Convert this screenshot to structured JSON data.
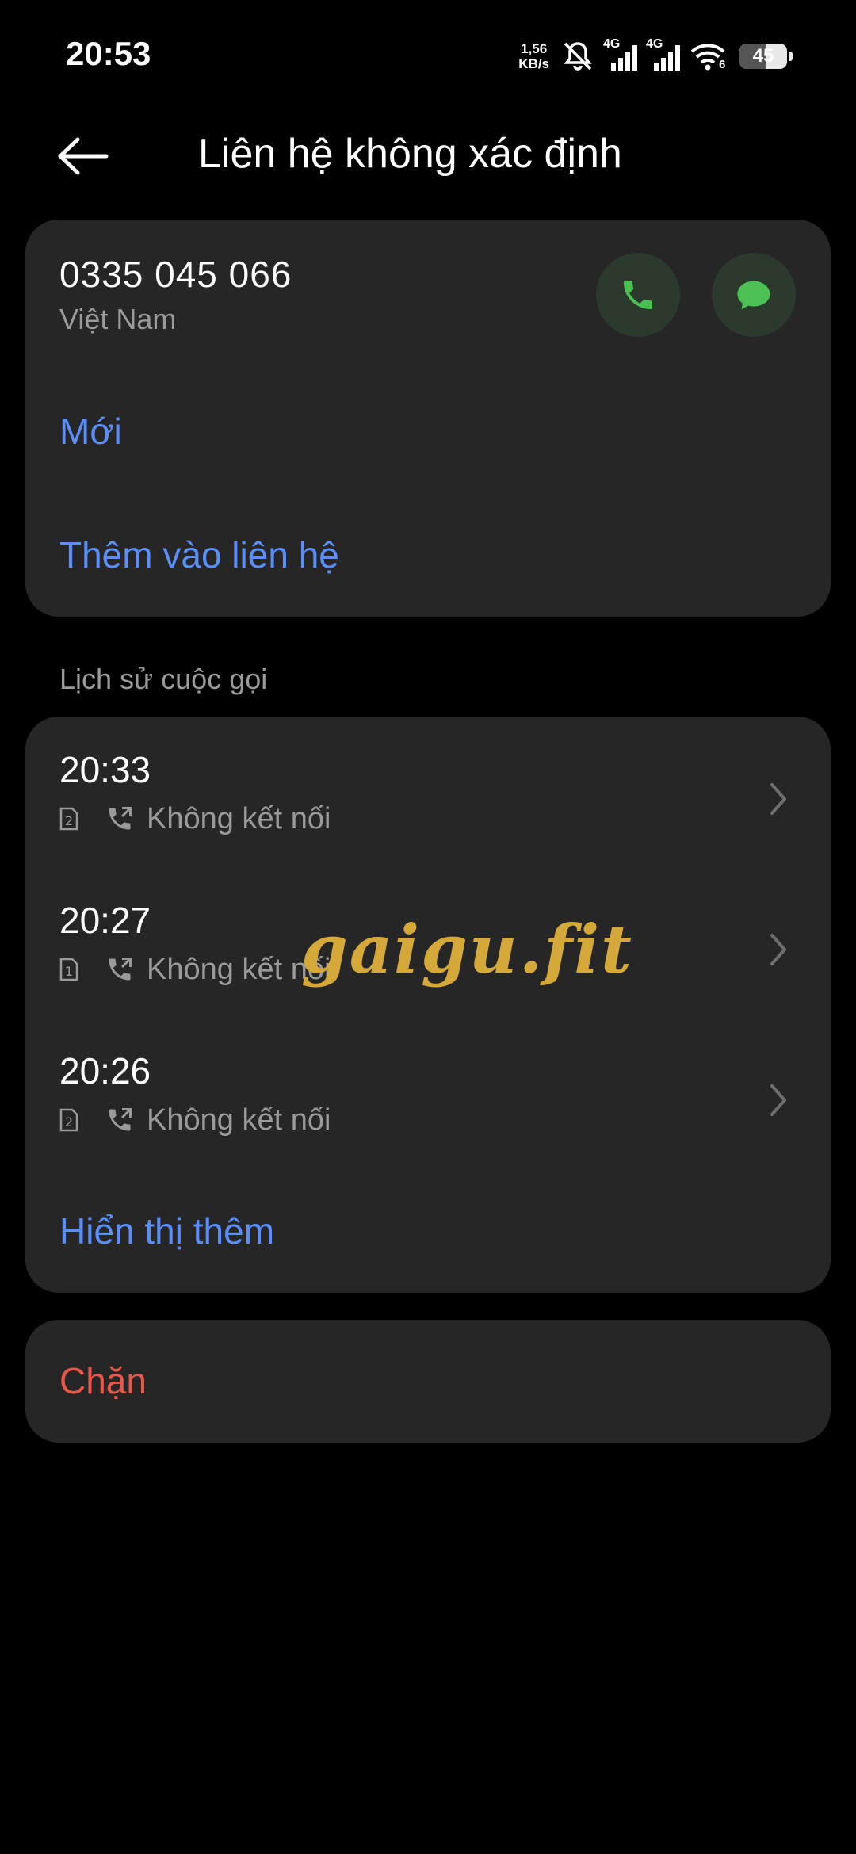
{
  "status_bar": {
    "time": "20:53",
    "net_speed_value": "1,56",
    "net_speed_unit": "KB/s",
    "sim1_label": "4G",
    "sim2_label": "4G",
    "wifi_label": "6",
    "battery": "45"
  },
  "header": {
    "title": "Liên hệ không xác định"
  },
  "contact": {
    "phone_number": "0335 045 066",
    "country": "Việt Nam",
    "new_label": "Mới",
    "add_to_contacts_label": "Thêm vào liên hệ"
  },
  "call_history": {
    "section_title": "Lịch sử cuộc gọi",
    "rows": [
      {
        "time": "20:33",
        "sim": "2",
        "status": "Không kết nối"
      },
      {
        "time": "20:27",
        "sim": "1",
        "status": "Không kết nối"
      },
      {
        "time": "20:26",
        "sim": "2",
        "status": "Không kết nối"
      }
    ],
    "show_more_label": "Hiển thị thêm"
  },
  "block": {
    "label": "Chặn"
  },
  "watermark": "gaigu.fit",
  "colors": {
    "background": "#000000",
    "card": "#262626",
    "accent_blue": "#5b8ef7",
    "danger_red": "#e8574a",
    "action_green": "#4cc153",
    "secondary_text": "#9a9a9a"
  }
}
